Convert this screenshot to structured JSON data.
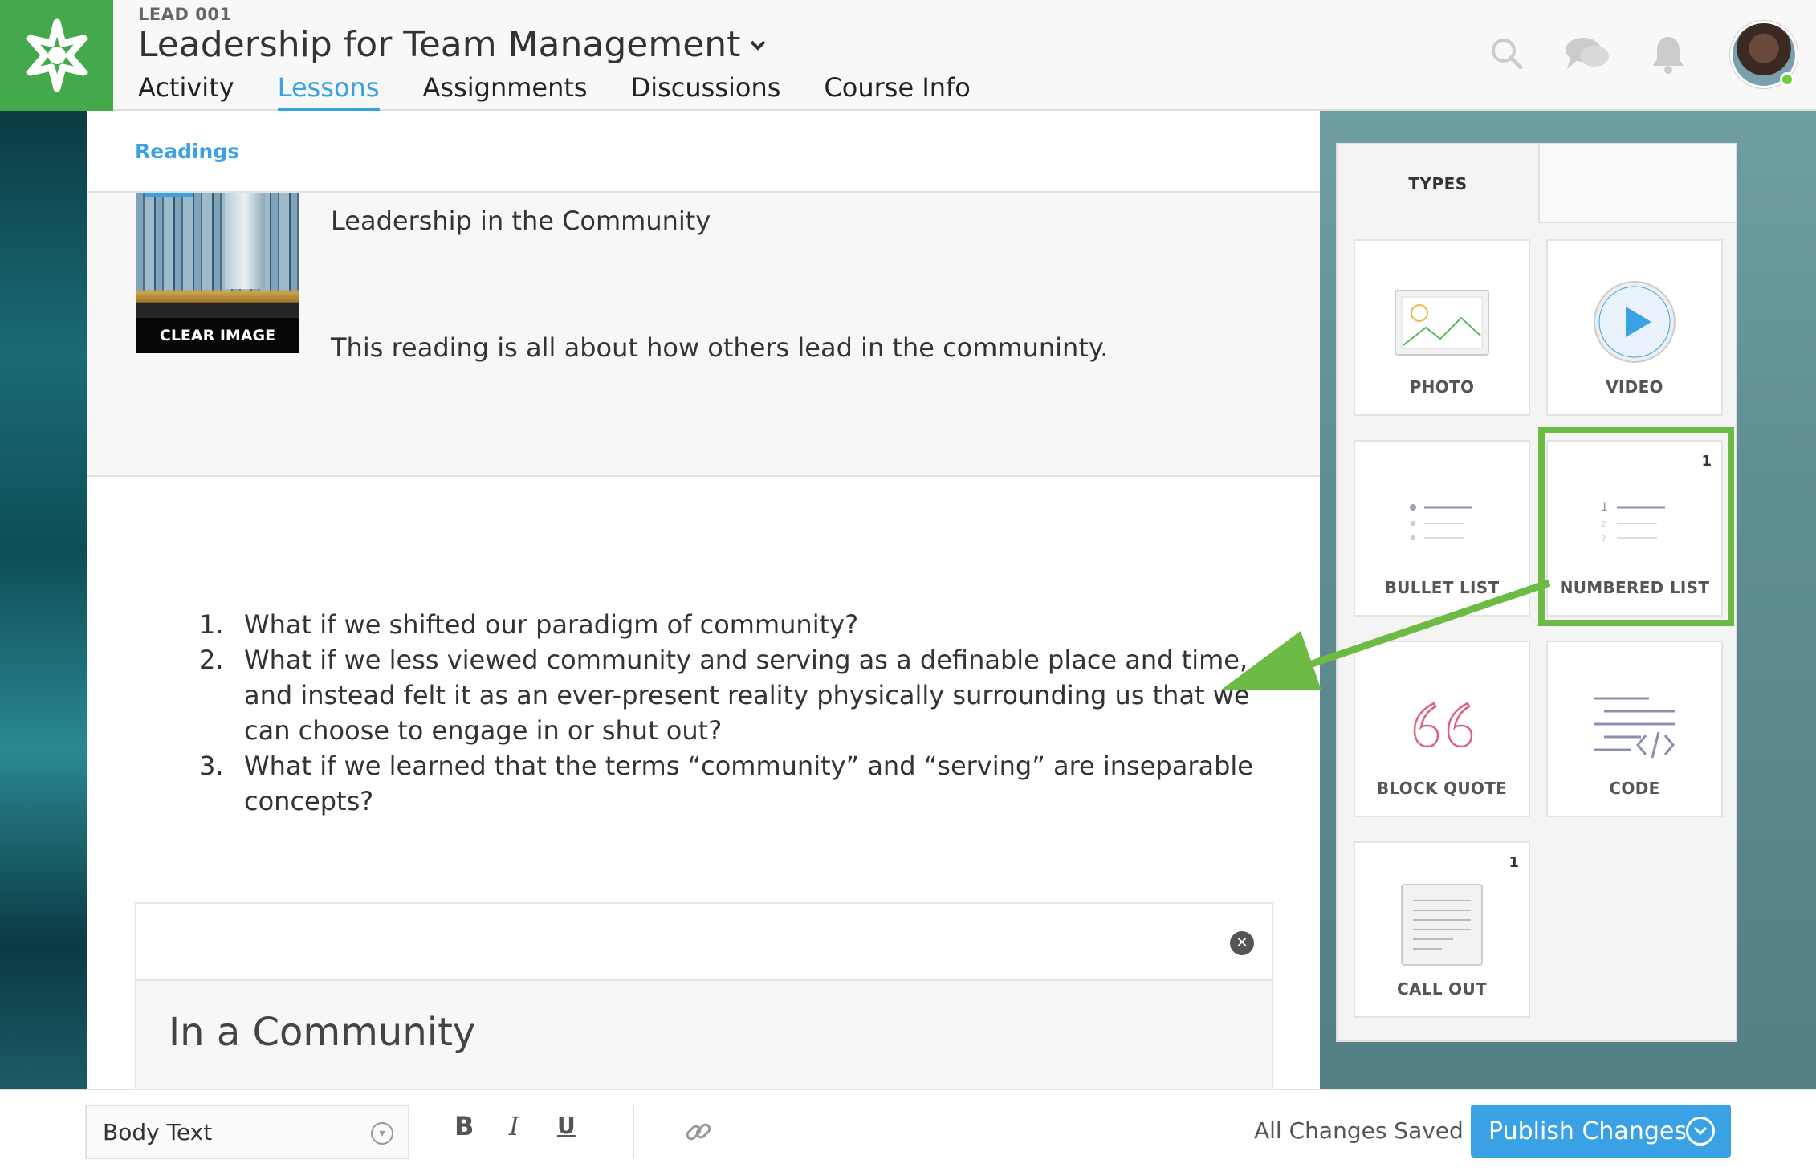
{
  "header": {
    "course_code": "LEAD 001",
    "course_title": "Leadership for Team Management",
    "tabs": [
      {
        "label": "Activity"
      },
      {
        "label": "Lessons"
      },
      {
        "label": "Assignments"
      },
      {
        "label": "Discussions"
      },
      {
        "label": "Course Info"
      }
    ],
    "active_tab": "Lessons",
    "icons": [
      "search-icon",
      "chat-icon",
      "bell-icon",
      "avatar"
    ]
  },
  "editor": {
    "breadcrumb": "Readings",
    "reading": {
      "clear_image_label": "CLEAR IMAGE",
      "title": "Leadership in the Community",
      "description": "This reading is all about how others lead in the communinty."
    },
    "numbered_list": [
      {
        "num": "1.",
        "text": "What if we shifted our paradigm of community?"
      },
      {
        "num": "2.",
        "text": "What if we less viewed community and serving as a definable place and time, and instead felt it as an ever-present reality physically surrounding us that we can choose to engage in or shut out?"
      },
      {
        "num": "3.",
        "text": "What if we learned that the terms “community” and “serving” are inseparable concepts?"
      }
    ],
    "callout": {
      "title": "In a Community"
    }
  },
  "types_panel": {
    "tab_label": "TYPES",
    "tiles": [
      {
        "label": "PHOTO",
        "icon": "photo-icon"
      },
      {
        "label": "VIDEO",
        "icon": "play-icon"
      },
      {
        "label": "BULLET LIST",
        "icon": "bullet-list-icon"
      },
      {
        "label": "NUMBERED LIST",
        "icon": "numbered-list-icon",
        "count": "1"
      },
      {
        "label": "BLOCK QUOTE",
        "icon": "quote-icon"
      },
      {
        "label": "CODE",
        "icon": "code-icon"
      },
      {
        "label": "CALL OUT",
        "icon": "callout-icon",
        "count": "1"
      }
    ],
    "highlight_color": "#6dbb45"
  },
  "toolbar": {
    "text_style": "Body Text",
    "bold": "B",
    "italic": "I",
    "underline": "U",
    "save_status": "All Changes Saved",
    "publish_label": "Publish Changes"
  },
  "colors": {
    "brand_green": "#44a94a",
    "accent_blue": "#3aa1e4"
  }
}
